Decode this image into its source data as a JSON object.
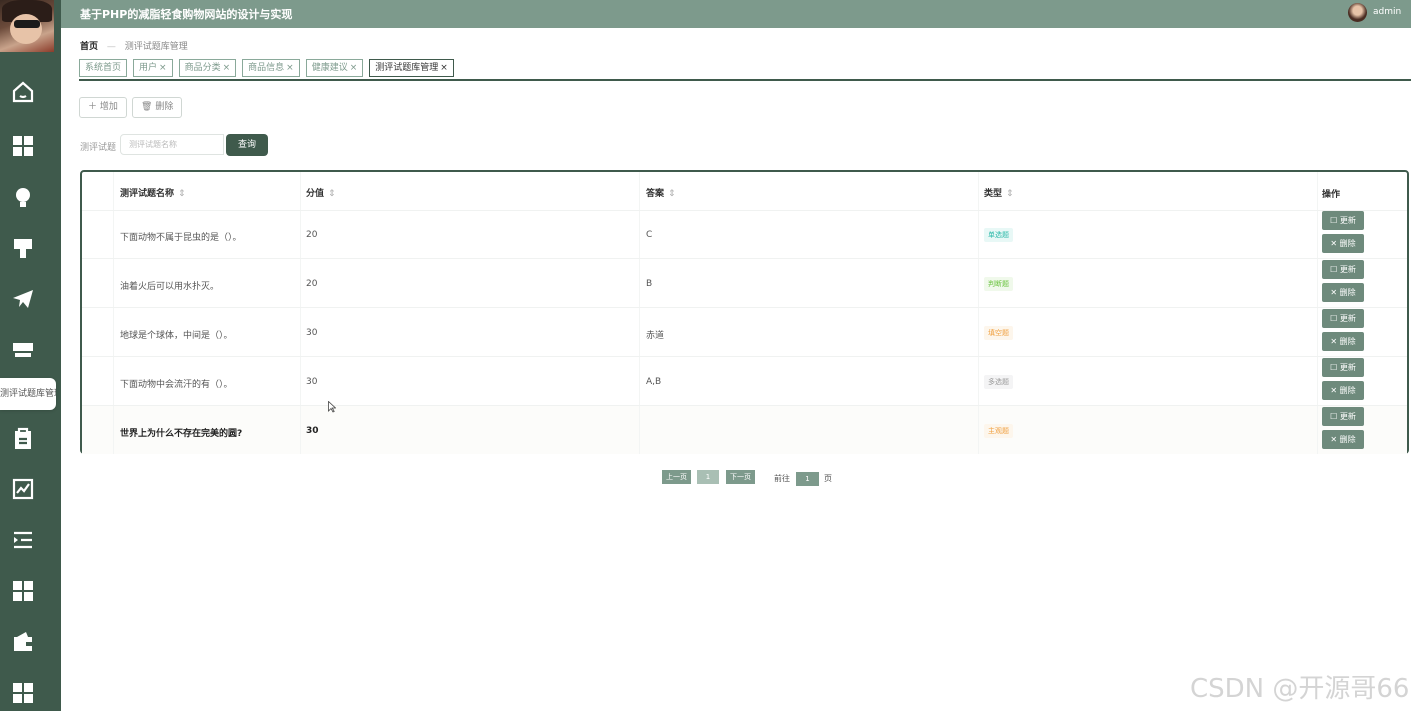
{
  "header": {
    "title": "基于PHP的减脂轻食购物网站的设计与实现",
    "username": "admin"
  },
  "sidebar": {
    "tooltip": "测评试题库管理",
    "icons": [
      "home-icon",
      "grid-icon",
      "bulb-icon",
      "brush-icon",
      "send-icon",
      "store-icon",
      "clipboard-icon",
      "chart-icon",
      "list-icon",
      "grid-icon",
      "wallet-icon",
      "grid-icon"
    ]
  },
  "breadcrumb": {
    "home": "首页",
    "current": "测评试题库管理"
  },
  "tabs": [
    {
      "label": "系统首页"
    },
    {
      "label": "用户",
      "close": "×"
    },
    {
      "label": "商品分类",
      "close": "×"
    },
    {
      "label": "商品信息",
      "close": "×"
    },
    {
      "label": "健康建议",
      "close": "×"
    },
    {
      "label": "测评试题库管理",
      "close": "×"
    }
  ],
  "toolbar": {
    "add_label": "增加",
    "delete_label": "删除"
  },
  "search": {
    "label": "测评试题",
    "placeholder": "测评试题名称",
    "button": "查询"
  },
  "table": {
    "headers": [
      "测评试题名称",
      "分值",
      "答案",
      "类型",
      "操作"
    ],
    "sort_icon": "⇕",
    "rows": [
      {
        "name": "下面动物不属于昆虫的是（）。",
        "score": "20",
        "answer": "C",
        "type": "单选题",
        "type_color": "#2ab8a8"
      },
      {
        "name": "油着火后可以用水扑灭。",
        "score": "20",
        "answer": "B",
        "type": "判断题",
        "type_color": "#67c23a"
      },
      {
        "name": "地球是个球体，中间是（）。",
        "score": "30",
        "answer": "赤道",
        "type": "填空题",
        "type_color": "#f0a040"
      },
      {
        "name": "下面动物中会流汗的有（）。",
        "score": "30",
        "answer": "A,B",
        "type": "多选题",
        "type_color": "#999999"
      },
      {
        "name": "世界上为什么不存在完美的圆?",
        "score": "30",
        "answer": "",
        "type": "主观题",
        "type_color": "#f0a040"
      }
    ],
    "update_label": "更新",
    "delete_label": "删除"
  },
  "pagination": {
    "prev": "上一页",
    "page": "1",
    "next": "下一页",
    "goto_prefix": "前往",
    "goto_value": "1",
    "goto_suffix": "页"
  },
  "watermark": "CSDN @开源哥66"
}
